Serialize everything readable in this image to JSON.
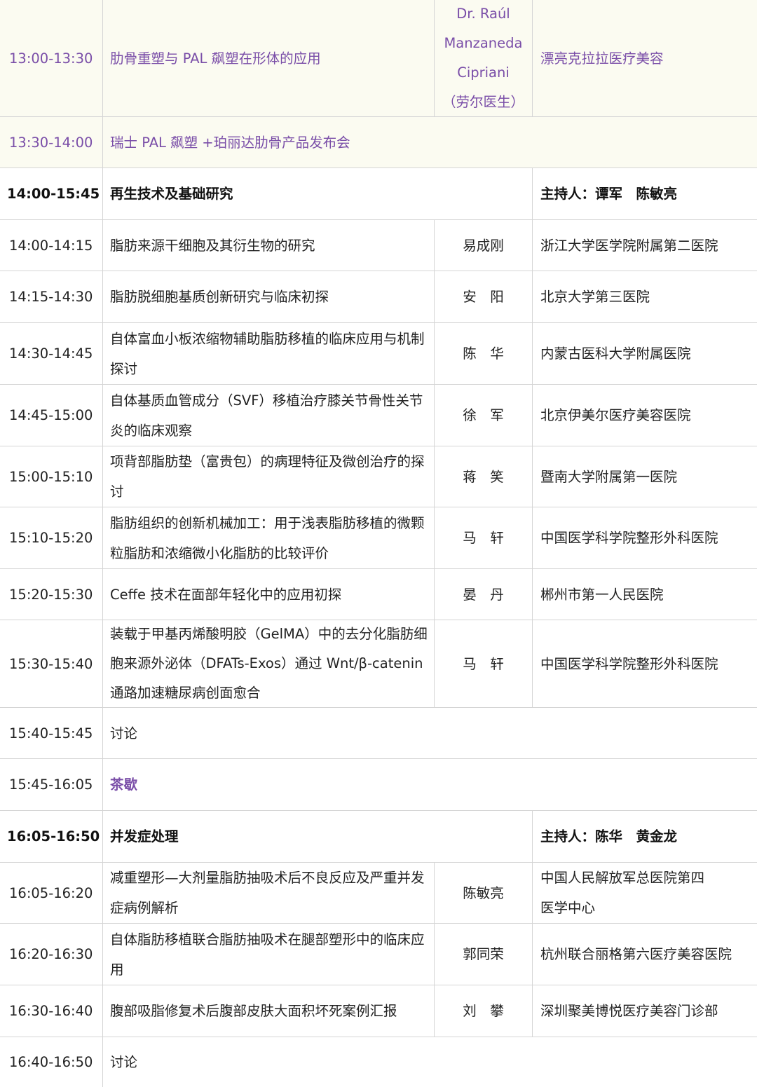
{
  "rows": [
    {
      "time": "13:00-13:30",
      "topic": "肋骨重塑与 PAL 飙塑在形体的应用",
      "speaker_lines": [
        "Dr. Raúl",
        "Manzaneda",
        "Cipriani",
        "（劳尔医生）"
      ],
      "org": "漂亮克拉拉医疗美容"
    },
    {
      "time": "13:30-14:00",
      "topic": "瑞士 PAL 飙塑 +珀丽达肋骨产品发布会"
    },
    {
      "time": "14:00-15:45",
      "topic": "再生技术及基础研究",
      "org": "主持人：谭军　陈敏亮"
    },
    {
      "time": "14:00-14:15",
      "topic": "脂肪来源干细胞及其衍生物的研究",
      "speaker": "易成刚",
      "org": "浙江大学医学院附属第二医院"
    },
    {
      "time": "14:15-14:30",
      "topic": "脂肪脱细胞基质创新研究与临床初探",
      "speaker": "安　阳",
      "org": "北京大学第三医院"
    },
    {
      "time": "14:30-14:45",
      "topic": "自体富血小板浓缩物辅助脂肪移植的临床应用与机制探讨",
      "speaker": "陈　华",
      "org": "内蒙古医科大学附属医院"
    },
    {
      "time": "14:45-15:00",
      "topic": "自体基质血管成分（SVF）移植治疗膝关节骨性关节炎的临床观察",
      "speaker": "徐　军",
      "org": "北京伊美尔医疗美容医院"
    },
    {
      "time": "15:00-15:10",
      "topic": "项背部脂肪垫（富贵包）的病理特征及微创治疗的探讨",
      "speaker": "蒋　笑",
      "org": "暨南大学附属第一医院"
    },
    {
      "time": "15:10-15:20",
      "topic": "脂肪组织的创新机械加工：用于浅表脂肪移植的微颗粒脂肪和浓缩微小化脂肪的比较评价",
      "speaker": "马　轩",
      "org": "中国医学科学院整形外科医院"
    },
    {
      "time": "15:20-15:30",
      "topic": "Ceffe 技术在面部年轻化中的应用初探",
      "speaker": "晏　丹",
      "org": "郴州市第一人民医院"
    },
    {
      "time": "15:30-15:40",
      "topic": "装载于甲基丙烯酸明胶（GelMA）中的去分化脂肪细胞来源外泌体（DFATs-Exos）通过 Wnt/β-catenin 通路加速糖尿病创面愈合",
      "speaker": "马　轩",
      "org": "中国医学科学院整形外科医院"
    },
    {
      "time": "15:40-15:45",
      "topic": "讨论"
    },
    {
      "time": "15:45-16:05",
      "topic": "茶歇"
    },
    {
      "time": "16:05-16:50",
      "topic": "并发症处理",
      "org": "主持人：陈华　黄金龙"
    },
    {
      "time": "16:05-16:20",
      "topic": "减重塑形—大剂量脂肪抽吸术后不良反应及严重并发症病例解析",
      "speaker": "陈敏亮",
      "org": "中国人民解放军总医院第四医学中心"
    },
    {
      "time": "16:20-16:30",
      "topic": "自体脂肪移植联合脂肪抽吸术在腿部塑形中的临床应用",
      "speaker": "郭同荣",
      "org": "杭州联合丽格第六医疗美容医院"
    },
    {
      "time": "16:30-16:40",
      "topic": "腹部吸脂修复术后腹部皮肤大面积坏死案例汇报",
      "speaker": "刘　攀",
      "org": "深圳聚美博悦医疗美容门诊部"
    },
    {
      "time": "16:40-16:50",
      "topic": "讨论"
    }
  ]
}
